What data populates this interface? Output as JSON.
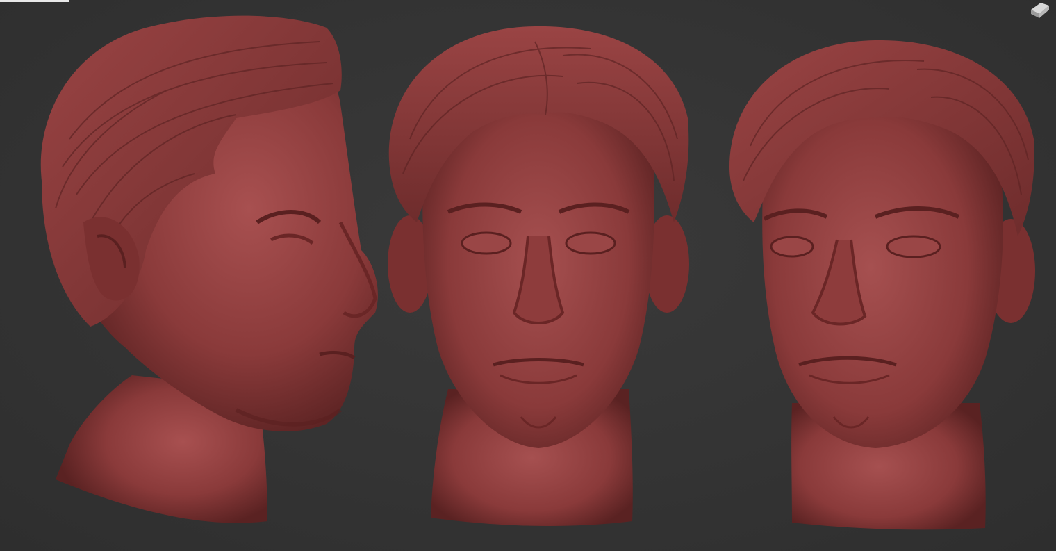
{
  "viewport": {
    "background": "#343434",
    "material_color": "#8e3a3a"
  },
  "views": [
    {
      "name": "side-view"
    },
    {
      "name": "front-view"
    },
    {
      "name": "three-quarter-view"
    }
  ],
  "icons": {
    "corner": "gizmo-cube-icon"
  }
}
